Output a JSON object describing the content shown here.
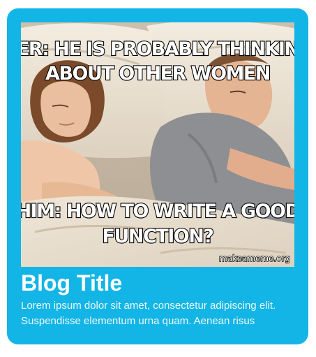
{
  "card": {
    "image": {
      "alt": "Meme: couple lying in bed",
      "top_text_line1": "HER: HE IS PROBABLY THINKING",
      "top_text_line2": "ABOUT OTHER WOMEN",
      "bottom_text_line1": "HIM: HOW TO WRITE A GOOD",
      "bottom_text_line2": "FUNCTION?",
      "watermark": "makeameme.org"
    },
    "title": "Blog Title",
    "excerpt": "Lorem ipsum dolor sit amet, consectetur adipiscing elit. Suspendisse elementum urna quam. Aenean risus"
  },
  "colors": {
    "card_background": "#12b5e5",
    "title_text": "#ffffff",
    "excerpt_text": "#eef9fd"
  }
}
